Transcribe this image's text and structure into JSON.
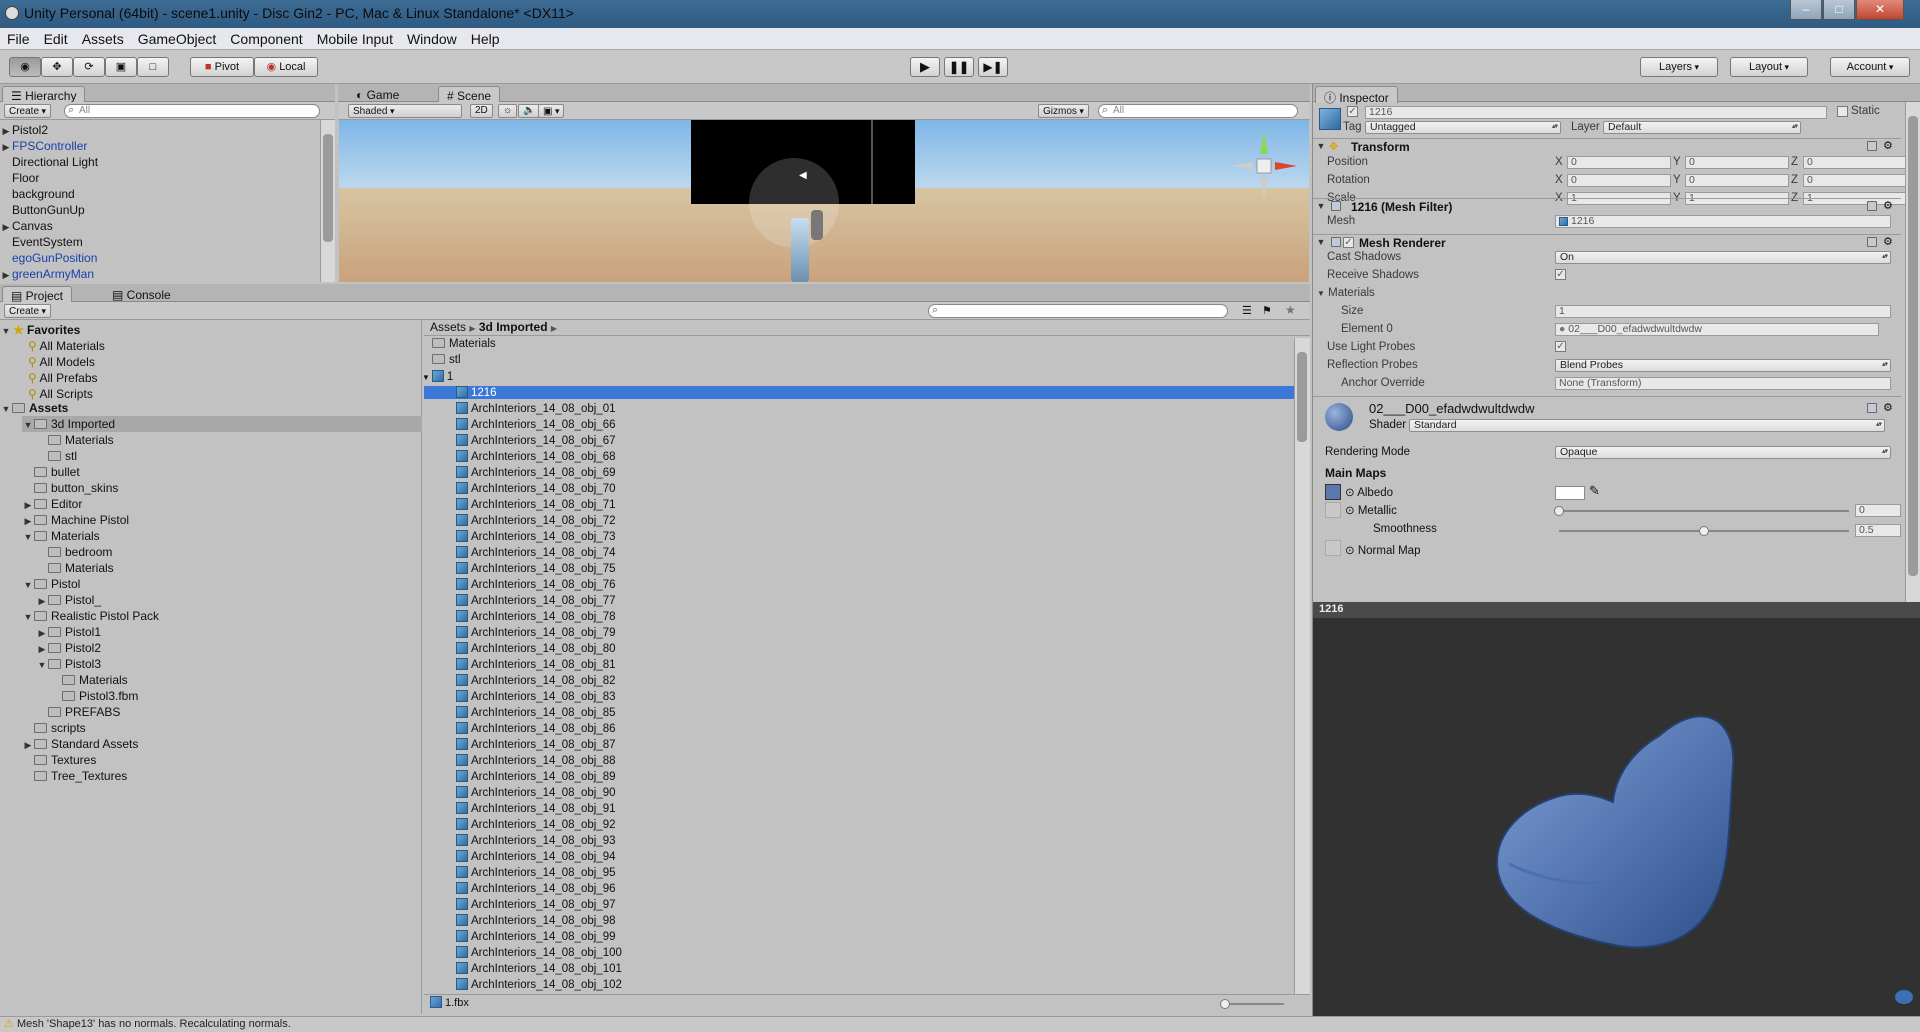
{
  "window": {
    "title": "Unity Personal (64bit) - scene1.unity - Disc Gin2 - PC, Mac & Linux Standalone* <DX11>",
    "minimize": "–",
    "maximize": "□",
    "close": "✕"
  },
  "menu": [
    "File",
    "Edit",
    "Assets",
    "GameObject",
    "Component",
    "Mobile Input",
    "Window",
    "Help"
  ],
  "toolbar": {
    "pivot": "Pivot",
    "local": "Local",
    "layers": "Layers",
    "layout": "Layout",
    "account": "Account"
  },
  "hierarchy": {
    "tab": "Hierarchy",
    "create": "Create",
    "search_placeholder": "All",
    "items": [
      {
        "label": "Pistol2",
        "arrow": "▶",
        "blue": false
      },
      {
        "label": "FPSController",
        "arrow": "▶",
        "blue": true
      },
      {
        "label": "Directional Light",
        "arrow": "",
        "blue": false
      },
      {
        "label": "Floor",
        "arrow": "",
        "blue": false
      },
      {
        "label": "background",
        "arrow": "",
        "blue": false
      },
      {
        "label": "ButtonGunUp",
        "arrow": "",
        "blue": false
      },
      {
        "label": "Canvas",
        "arrow": "▶",
        "blue": false
      },
      {
        "label": "EventSystem",
        "arrow": "",
        "blue": false
      },
      {
        "label": "egoGunPosition",
        "arrow": "",
        "blue": true
      },
      {
        "label": "greenArmyMan",
        "arrow": "▶",
        "blue": true
      }
    ]
  },
  "scene": {
    "tab_game": "Game",
    "tab_scene": "Scene",
    "shaded": "Shaded",
    "mode_2d": "2D",
    "gizmos": "Gizmos",
    "search_placeholder": "All"
  },
  "project": {
    "tab_project": "Project",
    "tab_console": "Console",
    "create": "Create",
    "favorites_label": "Favorites",
    "favorites": [
      "All Materials",
      "All Models",
      "All Prefabs",
      "All Scripts"
    ],
    "assets_label": "Assets",
    "tree": [
      {
        "label": "3d Imported",
        "depth": 1,
        "arrow": "▼",
        "sel": true
      },
      {
        "label": "Materials",
        "depth": 2,
        "arrow": "",
        "sel": false
      },
      {
        "label": "stl",
        "depth": 2,
        "arrow": "",
        "sel": false
      },
      {
        "label": "bullet",
        "depth": 1,
        "arrow": "",
        "sel": false
      },
      {
        "label": "button_skins",
        "depth": 1,
        "arrow": "",
        "sel": false
      },
      {
        "label": "Editor",
        "depth": 1,
        "arrow": "▶",
        "sel": false
      },
      {
        "label": "Machine Pistol",
        "depth": 1,
        "arrow": "▶",
        "sel": false
      },
      {
        "label": "Materials",
        "depth": 1,
        "arrow": "▼",
        "sel": false
      },
      {
        "label": "bedroom",
        "depth": 2,
        "arrow": "",
        "sel": false
      },
      {
        "label": "Materials",
        "depth": 2,
        "arrow": "",
        "sel": false
      },
      {
        "label": "Pistol",
        "depth": 1,
        "arrow": "▼",
        "sel": false
      },
      {
        "label": "Pistol_",
        "depth": 2,
        "arrow": "▶",
        "sel": false
      },
      {
        "label": "Realistic Pistol Pack",
        "depth": 1,
        "arrow": "▼",
        "sel": false
      },
      {
        "label": "Pistol1",
        "depth": 2,
        "arrow": "▶",
        "sel": false
      },
      {
        "label": "Pistol2",
        "depth": 2,
        "arrow": "▶",
        "sel": false
      },
      {
        "label": "Pistol3",
        "depth": 2,
        "arrow": "▼",
        "sel": false
      },
      {
        "label": "Materials",
        "depth": 3,
        "arrow": "",
        "sel": false
      },
      {
        "label": "Pistol3.fbm",
        "depth": 3,
        "arrow": "",
        "sel": false
      },
      {
        "label": "PREFABS",
        "depth": 2,
        "arrow": "",
        "sel": false
      },
      {
        "label": "scripts",
        "depth": 1,
        "arrow": "",
        "sel": false
      },
      {
        "label": "Standard Assets",
        "depth": 1,
        "arrow": "▶",
        "sel": false
      },
      {
        "label": "Textures",
        "depth": 1,
        "arrow": "",
        "sel": false
      },
      {
        "label": "Tree_Textures",
        "depth": 1,
        "arrow": "",
        "sel": false
      }
    ],
    "breadcrumb": [
      "Assets",
      "3d Imported"
    ],
    "list": [
      {
        "label": "Materials",
        "type": "folder",
        "depth": 0,
        "sel": false
      },
      {
        "label": "stl",
        "type": "folder",
        "depth": 0,
        "sel": false
      },
      {
        "label": "1",
        "type": "mesh",
        "depth": 0,
        "sel": false,
        "arrow": "▼"
      },
      {
        "label": "1216",
        "type": "mesh",
        "depth": 1,
        "sel": true
      },
      {
        "label": "ArchInteriors_14_08_obj_01",
        "type": "mesh",
        "depth": 1,
        "sel": false
      },
      {
        "label": "ArchInteriors_14_08_obj_66",
        "type": "mesh",
        "depth": 1,
        "sel": false
      },
      {
        "label": "ArchInteriors_14_08_obj_67",
        "type": "mesh",
        "depth": 1,
        "sel": false
      },
      {
        "label": "ArchInteriors_14_08_obj_68",
        "type": "mesh",
        "depth": 1,
        "sel": false
      },
      {
        "label": "ArchInteriors_14_08_obj_69",
        "type": "mesh",
        "depth": 1,
        "sel": false
      },
      {
        "label": "ArchInteriors_14_08_obj_70",
        "type": "mesh",
        "depth": 1,
        "sel": false
      },
      {
        "label": "ArchInteriors_14_08_obj_71",
        "type": "mesh",
        "depth": 1,
        "sel": false
      },
      {
        "label": "ArchInteriors_14_08_obj_72",
        "type": "mesh",
        "depth": 1,
        "sel": false
      },
      {
        "label": "ArchInteriors_14_08_obj_73",
        "type": "mesh",
        "depth": 1,
        "sel": false
      },
      {
        "label": "ArchInteriors_14_08_obj_74",
        "type": "mesh",
        "depth": 1,
        "sel": false
      },
      {
        "label": "ArchInteriors_14_08_obj_75",
        "type": "mesh",
        "depth": 1,
        "sel": false
      },
      {
        "label": "ArchInteriors_14_08_obj_76",
        "type": "mesh",
        "depth": 1,
        "sel": false
      },
      {
        "label": "ArchInteriors_14_08_obj_77",
        "type": "mesh",
        "depth": 1,
        "sel": false
      },
      {
        "label": "ArchInteriors_14_08_obj_78",
        "type": "mesh",
        "depth": 1,
        "sel": false
      },
      {
        "label": "ArchInteriors_14_08_obj_79",
        "type": "mesh",
        "depth": 1,
        "sel": false
      },
      {
        "label": "ArchInteriors_14_08_obj_80",
        "type": "mesh",
        "depth": 1,
        "sel": false
      },
      {
        "label": "ArchInteriors_14_08_obj_81",
        "type": "mesh",
        "depth": 1,
        "sel": false
      },
      {
        "label": "ArchInteriors_14_08_obj_82",
        "type": "mesh",
        "depth": 1,
        "sel": false
      },
      {
        "label": "ArchInteriors_14_08_obj_83",
        "type": "mesh",
        "depth": 1,
        "sel": false
      },
      {
        "label": "ArchInteriors_14_08_obj_85",
        "type": "mesh",
        "depth": 1,
        "sel": false
      },
      {
        "label": "ArchInteriors_14_08_obj_86",
        "type": "mesh",
        "depth": 1,
        "sel": false
      },
      {
        "label": "ArchInteriors_14_08_obj_87",
        "type": "mesh",
        "depth": 1,
        "sel": false
      },
      {
        "label": "ArchInteriors_14_08_obj_88",
        "type": "mesh",
        "depth": 1,
        "sel": false
      },
      {
        "label": "ArchInteriors_14_08_obj_89",
        "type": "mesh",
        "depth": 1,
        "sel": false
      },
      {
        "label": "ArchInteriors_14_08_obj_90",
        "type": "mesh",
        "depth": 1,
        "sel": false
      },
      {
        "label": "ArchInteriors_14_08_obj_91",
        "type": "mesh",
        "depth": 1,
        "sel": false
      },
      {
        "label": "ArchInteriors_14_08_obj_92",
        "type": "mesh",
        "depth": 1,
        "sel": false
      },
      {
        "label": "ArchInteriors_14_08_obj_93",
        "type": "mesh",
        "depth": 1,
        "sel": false
      },
      {
        "label": "ArchInteriors_14_08_obj_94",
        "type": "mesh",
        "depth": 1,
        "sel": false
      },
      {
        "label": "ArchInteriors_14_08_obj_95",
        "type": "mesh",
        "depth": 1,
        "sel": false
      },
      {
        "label": "ArchInteriors_14_08_obj_96",
        "type": "mesh",
        "depth": 1,
        "sel": false
      },
      {
        "label": "ArchInteriors_14_08_obj_97",
        "type": "mesh",
        "depth": 1,
        "sel": false
      },
      {
        "label": "ArchInteriors_14_08_obj_98",
        "type": "mesh",
        "depth": 1,
        "sel": false
      },
      {
        "label": "ArchInteriors_14_08_obj_99",
        "type": "mesh",
        "depth": 1,
        "sel": false
      },
      {
        "label": "ArchInteriors_14_08_obj_100",
        "type": "mesh",
        "depth": 1,
        "sel": false
      },
      {
        "label": "ArchInteriors_14_08_obj_101",
        "type": "mesh",
        "depth": 1,
        "sel": false
      },
      {
        "label": "ArchInteriors_14_08_obj_102",
        "type": "mesh",
        "depth": 1,
        "sel": false
      }
    ],
    "footer_file": "1.fbx"
  },
  "inspector": {
    "tab": "Inspector",
    "object_name": "1216",
    "static": "Static",
    "tag_label": "Tag",
    "tag": "Untagged",
    "layer_label": "Layer",
    "layer": "Default",
    "transform": {
      "title": "Transform",
      "position": "Position",
      "rotation": "Rotation",
      "scale": "Scale",
      "x": "X",
      "y": "Y",
      "z": "Z",
      "pos": [
        "0",
        "0",
        "0"
      ],
      "rot": [
        "0",
        "0",
        "0"
      ],
      "scl": [
        "1",
        "1",
        "1"
      ]
    },
    "meshfilter": {
      "title": "1216 (Mesh Filter)",
      "mesh_label": "Mesh",
      "mesh": "1216"
    },
    "renderer": {
      "title": "Mesh Renderer",
      "cast_label": "Cast Shadows",
      "cast": "On",
      "receive_label": "Receive Shadows",
      "materials_label": "Materials",
      "size_label": "Size",
      "size": "1",
      "el0_label": "Element 0",
      "el0": "02___D00_efadwdwultdwdw",
      "probes_label": "Use Light Probes",
      "refl_label": "Reflection Probes",
      "refl": "Blend Probes",
      "anchor_label": "Anchor Override",
      "anchor": "None (Transform)"
    },
    "material": {
      "name": "02___D00_efadwdwultdwdw",
      "shader_label": "Shader",
      "shader": "Standard",
      "render_mode_label": "Rendering Mode",
      "render_mode": "Opaque",
      "main_maps": "Main Maps",
      "albedo": "Albedo",
      "metallic": "Metallic",
      "metallic_val": "0",
      "smoothness": "Smoothness",
      "smoothness_val": "0.5",
      "normal": "Normal Map"
    },
    "metallic_level": 0,
    "smoothness_level": 0.5,
    "preview_title": "1216"
  },
  "status": {
    "message": "Mesh 'Shape13' has no normals. Recalculating normals."
  },
  "colors": {
    "selection": "#3c78d8",
    "mesh_blue": "#4a6fa8"
  }
}
